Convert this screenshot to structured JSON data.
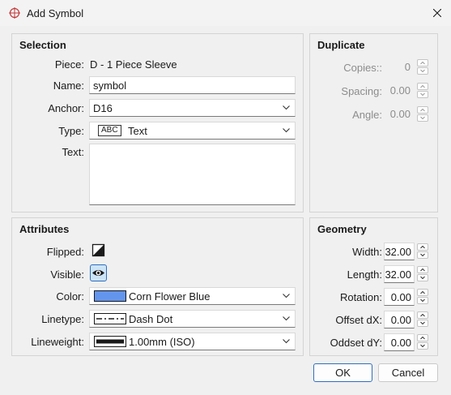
{
  "window": {
    "title": "Add Symbol",
    "close_label": "close"
  },
  "selection": {
    "title": "Selection",
    "piece_label": "Piece:",
    "piece_value": "D - 1 Piece Sleeve",
    "name_label": "Name:",
    "name_value": "symbol",
    "anchor_label": "Anchor:",
    "anchor_value": "D16",
    "type_label": "Type:",
    "type_icon_text": "ABC",
    "type_value": "Text",
    "text_label": "Text:",
    "text_value": ""
  },
  "duplicate": {
    "title": "Duplicate",
    "copies_label": "Copies::",
    "copies_value": "0",
    "spacing_label": "Spacing:",
    "spacing_value": "0.00",
    "angle_label": "Angle:",
    "angle_value": "0.00"
  },
  "attributes": {
    "title": "Attributes",
    "flipped_label": "Flipped:",
    "visible_label": "Visible:",
    "color_label": "Color:",
    "color_value": "Corn Flower Blue",
    "color_swatch": "#6495ed",
    "linetype_label": "Linetype:",
    "linetype_value": "Dash Dot",
    "lineweight_label": "Lineweight:",
    "lineweight_value": "1.00mm (ISO)"
  },
  "geometry": {
    "title": "Geometry",
    "width_label": "Width:",
    "width_value": "32.00",
    "length_label": "Length:",
    "length_value": "32.00",
    "rotation_label": "Rotation:",
    "rotation_value": "0.00",
    "offset_dx_label": "Offset dX:",
    "offset_dx_value": "0.00",
    "offset_dy_label": "Oddset dY:",
    "offset_dy_value": "0.00"
  },
  "buttons": {
    "ok": "OK",
    "cancel": "Cancel"
  },
  "colors": {
    "accent": "#2f6fc0",
    "visible_toggle_bg": "#cce4f7"
  }
}
